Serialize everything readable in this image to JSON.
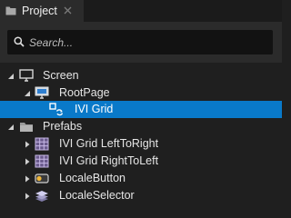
{
  "tab": {
    "title": "Project",
    "icon": "folder-icon",
    "close_icon": "close-icon"
  },
  "search": {
    "placeholder": "Search...",
    "value": "",
    "icon": "search-icon"
  },
  "tree": {
    "screen": {
      "label": "Screen",
      "icon": "monitor-icon",
      "expanded": true
    },
    "rootpage": {
      "label": "RootPage",
      "icon": "page-icon",
      "expanded": true
    },
    "ivi_grid": {
      "label": "IVI Grid",
      "icon": "grid-binding-icon",
      "selected": true
    },
    "prefabs": {
      "label": "Prefabs",
      "icon": "folder-icon",
      "expanded": true
    },
    "prefab_items": [
      {
        "label": "IVI Grid LeftToRight",
        "icon": "grid-icon",
        "expanded": false
      },
      {
        "label": "IVI Grid RightToLeft",
        "icon": "grid-icon",
        "expanded": false
      },
      {
        "label": "LocaleButton",
        "icon": "button-icon",
        "expanded": false
      },
      {
        "label": "LocaleSelector",
        "icon": "layers-icon",
        "expanded": false
      }
    ]
  },
  "colors": {
    "background": "#1f1f1f",
    "panel": "#2b2b2b",
    "search_bg": "#121212",
    "selection": "#0979c9",
    "text": "#e6e6e6"
  }
}
